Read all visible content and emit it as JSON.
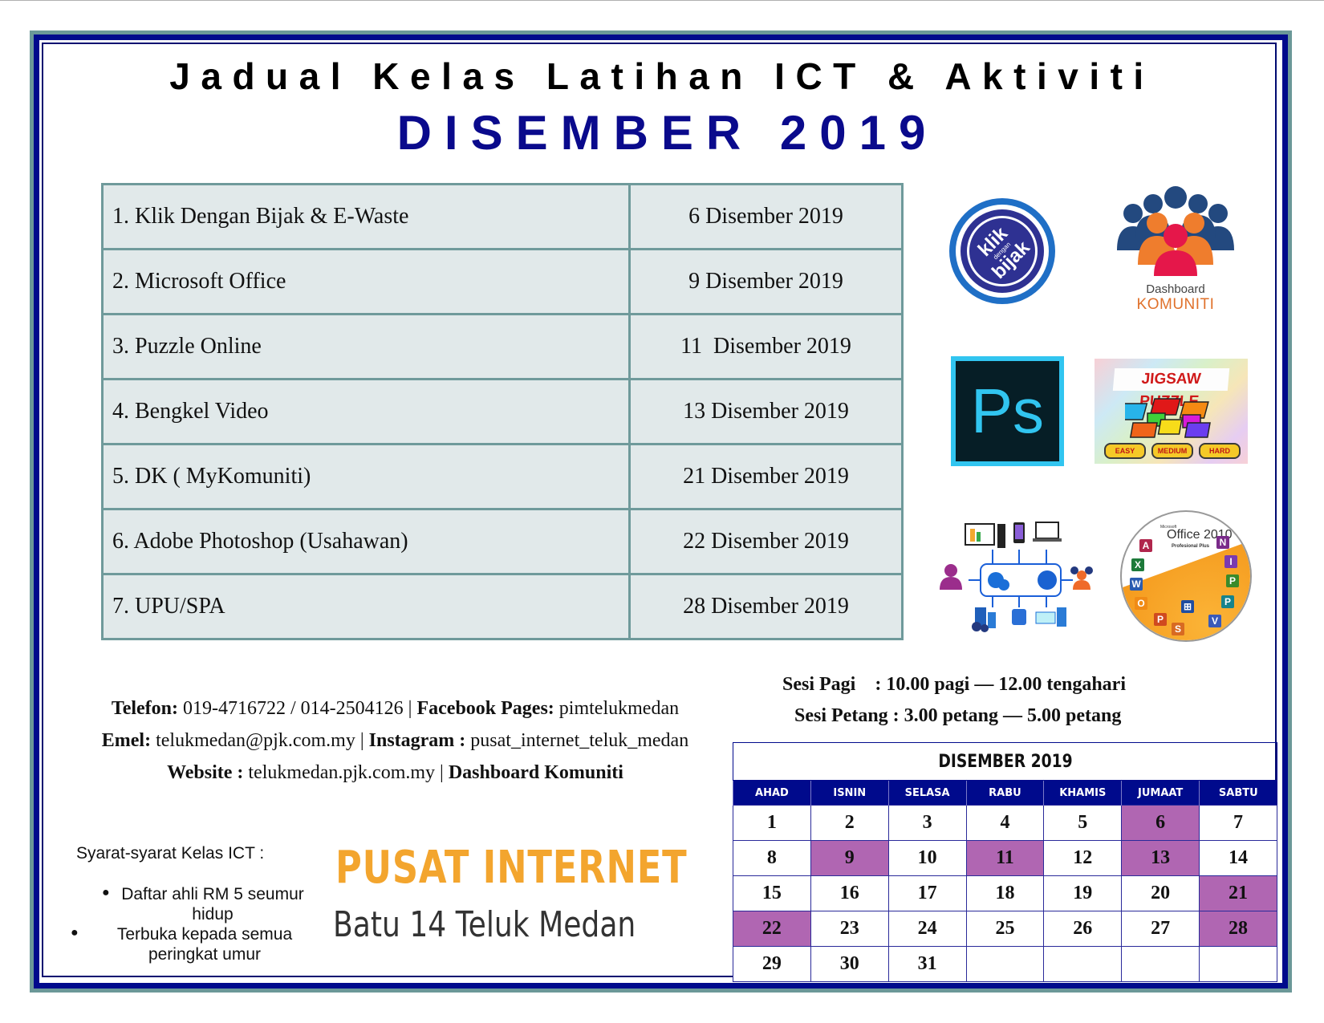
{
  "header": {
    "title": "Jadual Kelas Latihan ICT & Aktiviti",
    "subtitle": "DISEMBER 2019"
  },
  "schedule": [
    {
      "name": "1. Klik Dengan Bijak &  E-Waste",
      "date": "6 Disember 2019"
    },
    {
      "name": "2. Microsoft Office",
      "date": "9 Disember 2019"
    },
    {
      "name": "3. Puzzle Online",
      "date": "11  Disember 2019"
    },
    {
      "name": "4. Bengkel Video",
      "date": "13 Disember 2019"
    },
    {
      "name": "5. DK ( MyKomuniti)",
      "date": "21 Disember 2019"
    },
    {
      "name": "6. Adobe Photoshop (Usahawan)",
      "date": "22 Disember 2019"
    },
    {
      "name": "7. UPU/SPA",
      "date": "28 Disember 2019"
    }
  ],
  "logos": {
    "klik": {
      "line1": "klik",
      "line2": "dengan",
      "line3": "bijak"
    },
    "dashboard": {
      "line1": "Dashboard",
      "line2": "KOMUNITI"
    },
    "photoshop": {
      "label": "Ps"
    },
    "jigsaw": {
      "title": "JIGSAW PUZZLE",
      "buttons": [
        "EASY",
        "MEDIUM",
        "HARD"
      ]
    },
    "office": {
      "brand": "Microsoft",
      "name": "Office 2010",
      "edition": "Profesional Plus"
    }
  },
  "contact": {
    "phone_label": "Telefon:",
    "phone": " 019-4716722 / 014-2504126 | ",
    "facebook_label": "Facebook Pages:",
    "facebook": " pimtelukmedan",
    "email_label": "Emel:",
    "email": " telukmedan@pjk.com.my | ",
    "instagram_label": "Instagram :",
    "instagram": " pusat_internet_teluk_medan",
    "website_label": "Website :",
    "website": " telukmedan.pjk.com.my  | ",
    "dashboard_label": "Dashboard Komuniti"
  },
  "sessions": {
    "morning": "Sesi Pagi    : 10.00 pagi — 12.00 tengahari",
    "afternoon": "Sesi Petang : 3.00 petang — 5.00 petang"
  },
  "calendar": {
    "title": "DISEMBER 2019",
    "days": [
      "AHAD",
      "ISNIN",
      "SELASA",
      "RABU",
      "KHAMIS",
      "JUMAAT",
      "SABTU"
    ],
    "weeks": [
      [
        "1",
        "2",
        "3",
        "4",
        "5",
        "6",
        "7"
      ],
      [
        "8",
        "9",
        "10",
        "11",
        "12",
        "13",
        "14"
      ],
      [
        "15",
        "16",
        "17",
        "18",
        "19",
        "20",
        "21"
      ],
      [
        "22",
        "23",
        "24",
        "25",
        "26",
        "27",
        "28"
      ],
      [
        "29",
        "30",
        "31",
        "",
        "",
        "",
        ""
      ]
    ],
    "highlighted": [
      "6",
      "9",
      "11",
      "13",
      "21",
      "22",
      "28"
    ],
    "highlight_color": "#b066b2"
  },
  "requirements": {
    "title": "Syarat-syarat Kelas ICT :",
    "items": [
      "Daftar ahli RM 5 seumur hidup",
      "Terbuka kepada semua peringkat umur"
    ]
  },
  "branding": {
    "line1": "PUSAT INTERNET",
    "line2": "Batu 14 Teluk Medan"
  },
  "colors": {
    "navy": "#000a8c",
    "frame_teal": "#6b9898",
    "table_bg": "#e1e9ea",
    "table_border": "#6f9a9b",
    "brand_orange": "#f3a52e"
  }
}
